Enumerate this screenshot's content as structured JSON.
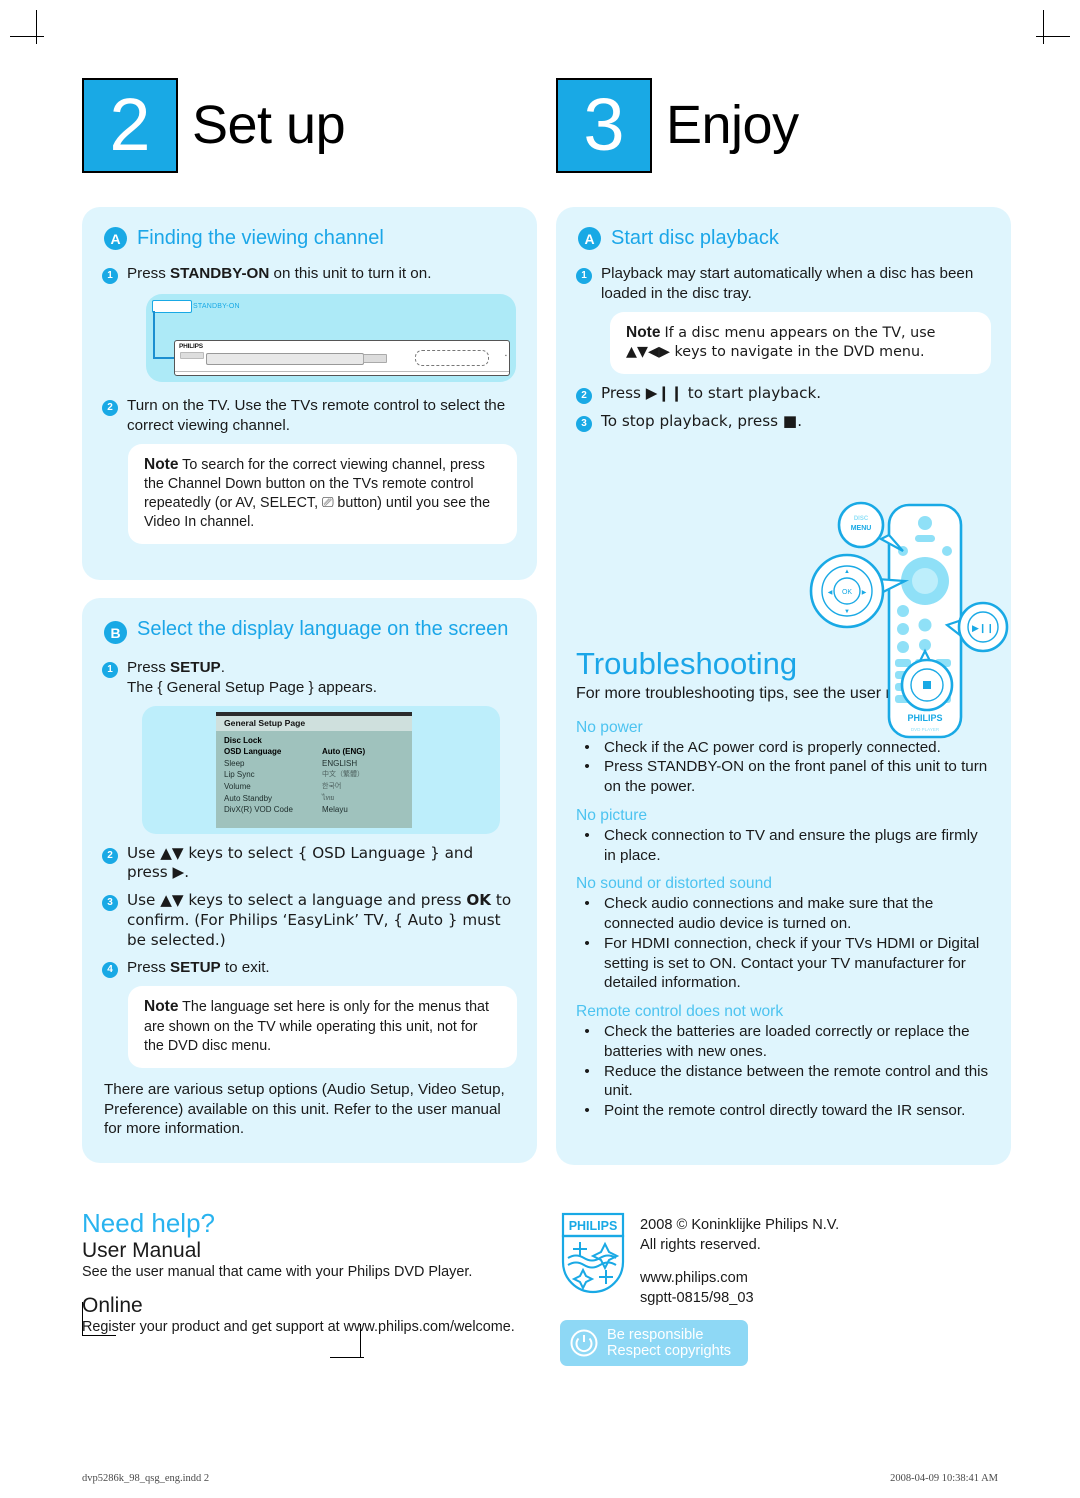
{
  "colors": {
    "brand_blue": "#19a9e5",
    "heading_blue": "#1ba6e8",
    "panel_bg": "#dff5fd",
    "ts_subhead": "#4cc3f0"
  },
  "left": {
    "step_number": "2",
    "step_title": "Set up",
    "section_a": {
      "badge": "A",
      "title": "Finding the viewing channel",
      "steps": [
        {
          "num": "1",
          "html": "Press <b>STANDBY-ON</b> on this unit to turn it on."
        },
        {
          "num": "2",
          "html": "Turn on the TV. Use the TVs remote control to select the correct viewing channel."
        }
      ],
      "device_label": "STANDBY-ON",
      "device_brand": "PHILIPS",
      "note": {
        "label": "Note",
        "text": "To search for the correct viewing channel, press the Channel Down button on the TVs remote control repeatedly (or AV, SELECT, ⎚ button) until you see the Video In channel."
      }
    },
    "section_b": {
      "badge": "B",
      "title": "Select the display language on the screen",
      "step1": {
        "num": "1",
        "html": "Press <b>SETUP</b>.<br>The { General Setup Page } appears."
      },
      "osd": {
        "title": "General Setup Page",
        "rows": [
          {
            "label": "Disc Lock",
            "value": "",
            "selected": false,
            "dim": false
          },
          {
            "label": "OSD Language",
            "value": "Auto (ENG)",
            "selected": true,
            "dim": false
          },
          {
            "label": "Sleep",
            "value": "ENGLISH",
            "selected": false,
            "dim": false
          },
          {
            "label": "Lip Sync",
            "value": "中文（繁體）",
            "selected": false,
            "dim": true
          },
          {
            "label": "Volume",
            "value": "한국어",
            "selected": false,
            "dim": true
          },
          {
            "label": "Auto Standby",
            "value": "ไทย",
            "selected": false,
            "dim": true
          },
          {
            "label": "DivX(R) VOD Code",
            "value": "Melayu",
            "selected": false,
            "dim": false
          }
        ]
      },
      "steps": [
        {
          "num": "2",
          "html": "Use ▲▼ keys to select { OSD Language } and press ▶."
        },
        {
          "num": "3",
          "html": "Use ▲▼ keys to select a language and press <b>OK</b> to confirm. (For Philips ‘EasyLink’ TV, { Auto } must be selected.)"
        },
        {
          "num": "4",
          "html": "Press <b>SETUP</b> to exit."
        }
      ],
      "note": {
        "label": "Note",
        "text": "The language set here is only for the menus that are shown on the TV while operating this unit, not for the DVD disc menu."
      },
      "paragraph": "There are various setup options (Audio Setup, Video Setup, Preference) available on this unit. Refer to the user manual for more information."
    }
  },
  "right": {
    "step_number": "3",
    "step_title": "Enjoy",
    "section_a": {
      "badge": "A",
      "title": "Start disc playback",
      "steps": [
        {
          "num": "1",
          "html": "Playback may start automatically when a disc has been loaded in the disc tray."
        },
        {
          "num": "2",
          "html": "Press ▶❙❙ to start playback."
        },
        {
          "num": "3",
          "html": "To stop playback, press ■."
        }
      ],
      "note": {
        "label": "Note",
        "text": "If a disc menu appears on the TV, use ▲▼◀▶ keys to navigate in the DVD menu."
      },
      "remote": {
        "disc_menu_label_1": "DISC",
        "disc_menu_label_2": "MENU",
        "ok_label": "OK",
        "brand": "PHILIPS",
        "brand_sub": "DVD PLAYER"
      }
    },
    "troubleshooting": {
      "title": "Troubleshooting",
      "intro": "For more troubleshooting tips, see the user manual.",
      "groups": [
        {
          "heading": "No power",
          "items": [
            "Check if the AC power cord is properly connected.",
            "Press STANDBY-ON on the front panel of this unit to turn on the power."
          ]
        },
        {
          "heading": "No picture",
          "items": [
            "Check connection to TV and ensure the plugs are firmly in place."
          ]
        },
        {
          "heading": "No sound or distorted sound",
          "items": [
            "Check audio connections and make sure that the connected audio device is turned on.",
            "For HDMI connection, check if your TVs HDMI or Digital setting is set to ON. Contact your TV manufacturer for detailed information."
          ]
        },
        {
          "heading": "Remote control does not work",
          "items": [
            "Check the batteries are loaded correctly or replace the batteries with new ones.",
            "Reduce the distance between the remote control and this unit.",
            "Point the remote control directly toward the IR sensor."
          ]
        }
      ]
    }
  },
  "need_help": {
    "title": "Need help?",
    "user_manual_title": "User Manual",
    "user_manual_text": "See the user manual that came with your Philips DVD Player.",
    "online_title": "Online",
    "online_text": "Register your product and get support at www.philips.com/welcome."
  },
  "copyright": {
    "line1": "2008 © Koninklijke Philips N.V.",
    "line2": "All rights reserved.",
    "line3": "www.philips.com",
    "line4": "sgptt-0815/98_03",
    "logo_text": "PHILIPS",
    "responsible_line1": "Be responsible",
    "responsible_line2": "Respect copyrights"
  },
  "print_footer": {
    "left": "dvp5286k_98_qsg_eng.indd   2",
    "right": "2008-04-09   10:38:41 AM"
  }
}
